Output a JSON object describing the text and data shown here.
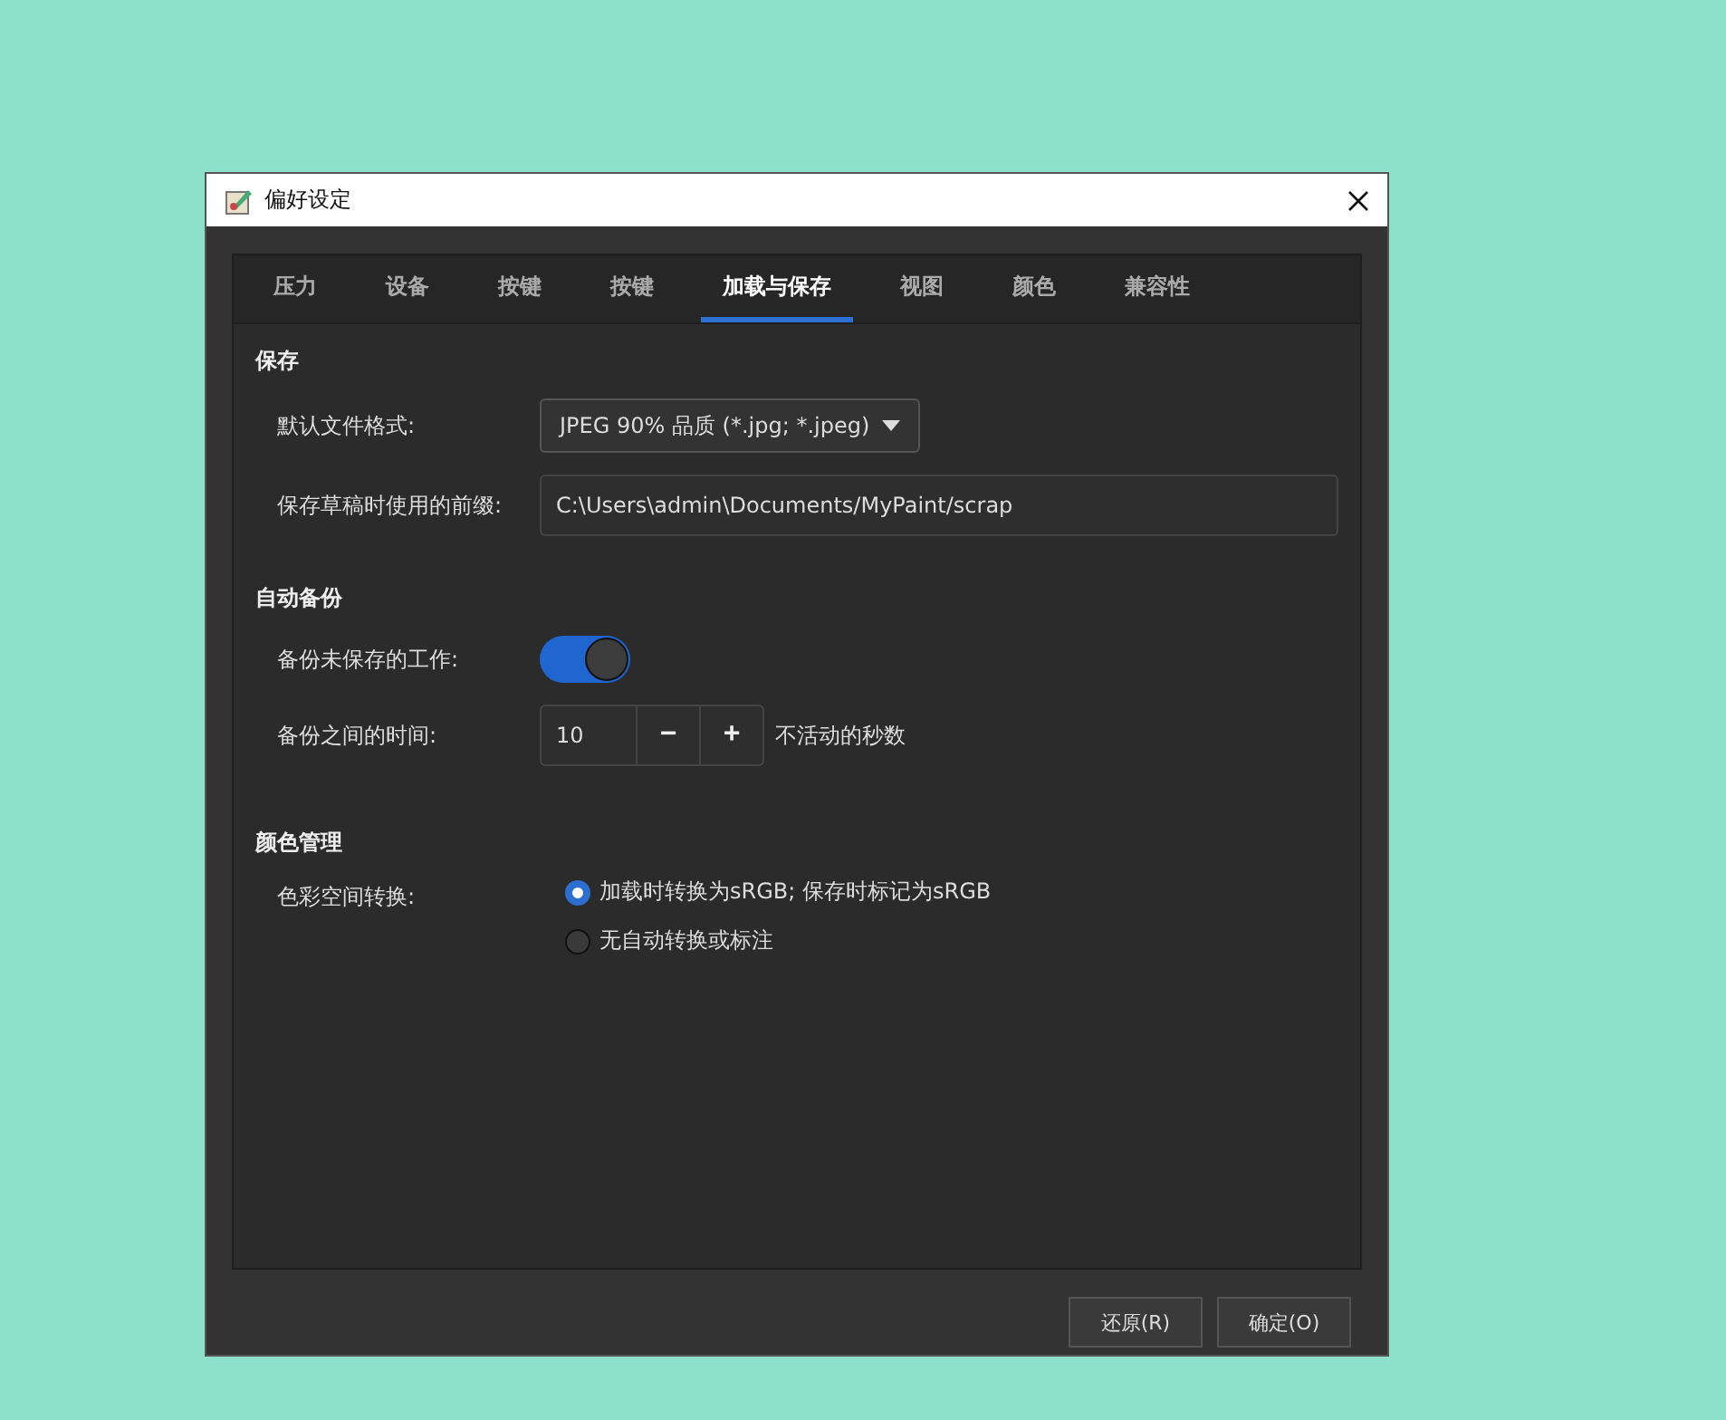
{
  "window": {
    "title": "偏好设定"
  },
  "tabs": [
    {
      "label": "压力",
      "selected": false
    },
    {
      "label": "设备",
      "selected": false
    },
    {
      "label": "按键",
      "selected": false
    },
    {
      "label": "按键",
      "selected": false
    },
    {
      "label": "加载与保存",
      "selected": true
    },
    {
      "label": "视图",
      "selected": false
    },
    {
      "label": "颜色",
      "selected": false
    },
    {
      "label": "兼容性",
      "selected": false
    }
  ],
  "save": {
    "heading": "保存",
    "format_label": "默认文件格式:",
    "format_value": "JPEG 90% 品质 (*.jpg; *.jpeg)",
    "prefix_label": "保存草稿时使用的前缀:",
    "prefix_value": "C:\\Users\\admin\\Documents/MyPaint/scrap"
  },
  "autosave": {
    "heading": "自动备份",
    "backup_label": "备份未保存的工作:",
    "backup_on": true,
    "interval_label": "备份之间的时间:",
    "interval_value": "10",
    "minus": "−",
    "plus": "+",
    "interval_unit": "不活动的秒数"
  },
  "color": {
    "heading": "颜色管理",
    "label": "色彩空间转换:",
    "options": [
      {
        "label": "加载时转换为sRGB; 保存时标记为sRGB",
        "selected": true
      },
      {
        "label": "无自动转换或标注",
        "selected": false
      }
    ]
  },
  "buttons": [
    "还原(R)",
    "确定(O)"
  ]
}
